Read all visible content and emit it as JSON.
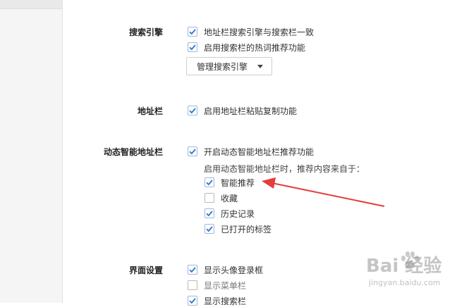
{
  "sections": {
    "search": {
      "label": "搜索引擎",
      "options": [
        {
          "label": "地址栏搜索引擎与搜索栏一致",
          "checked": true
        },
        {
          "label": "启用搜索栏的热词推荐功能",
          "checked": true
        }
      ],
      "manage_button": "管理搜索引擎"
    },
    "address": {
      "label": "地址栏",
      "options": [
        {
          "label": "启用地址栏粘贴复制功能",
          "checked": true
        }
      ]
    },
    "smart": {
      "label": "动态智能地址栏",
      "options": [
        {
          "label": "开启动态智能地址栏推荐功能",
          "checked": true
        }
      ],
      "note": "启用动态智能地址栏时，推荐内容来自于：",
      "sources": [
        {
          "label": "智能推荐",
          "checked": true
        },
        {
          "label": "收藏",
          "checked": false
        },
        {
          "label": "历史记录",
          "checked": true
        },
        {
          "label": "已打开的标签",
          "checked": true
        }
      ]
    },
    "ui": {
      "label": "界面设置",
      "options": [
        {
          "label": "显示头像登录框",
          "checked": true
        },
        {
          "label": "显示菜单栏",
          "checked": false
        },
        {
          "label": "显示搜索栏",
          "checked": true
        }
      ]
    }
  },
  "watermark": {
    "logo": "Bai 经验",
    "url": "jingyan.baidu.com"
  },
  "colors": {
    "check": "#2b76d2",
    "arrow": "#e43d3d"
  }
}
